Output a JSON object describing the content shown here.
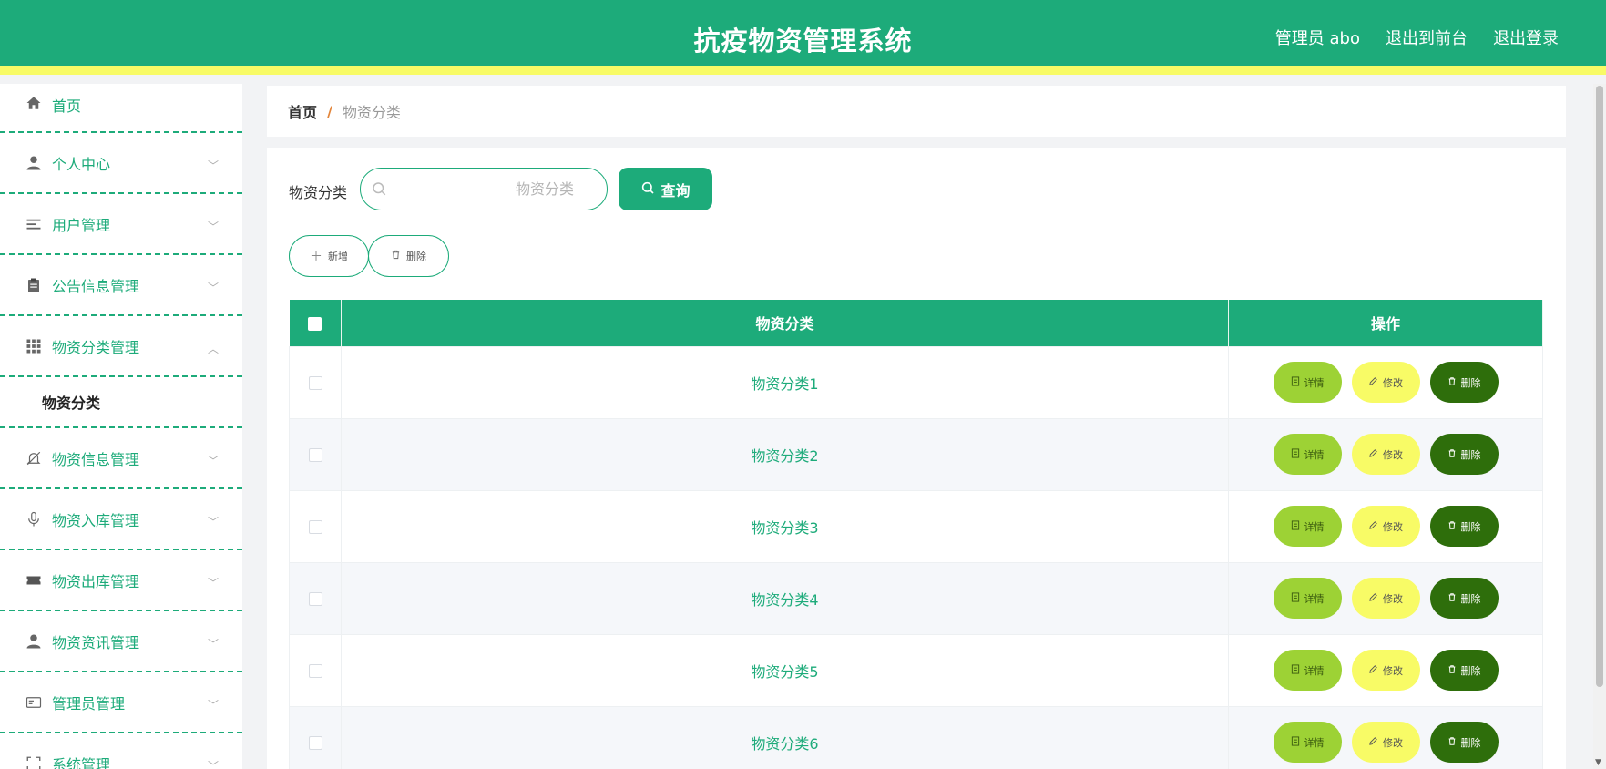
{
  "header": {
    "title": "抗疫物资管理系统",
    "user": "管理员 abo",
    "front_link": "退出到前台",
    "logout": "退出登录"
  },
  "sidebar": {
    "items": [
      {
        "label": "首页",
        "icon": "home-icon"
      },
      {
        "label": "个人中心",
        "icon": "user-icon"
      },
      {
        "label": "用户管理",
        "icon": "list-icon"
      },
      {
        "label": "公告信息管理",
        "icon": "clipboard-icon"
      },
      {
        "label": "物资分类管理",
        "icon": "grid-icon",
        "expanded": true,
        "sub": "物资分类"
      },
      {
        "label": "物资信息管理",
        "icon": "bell-off-icon"
      },
      {
        "label": "物资入库管理",
        "icon": "microphone-icon"
      },
      {
        "label": "物资出库管理",
        "icon": "ticket-icon"
      },
      {
        "label": "物资资讯管理",
        "icon": "person-icon"
      },
      {
        "label": "管理员管理",
        "icon": "id-card-icon"
      },
      {
        "label": "系统管理",
        "icon": "fullscreen-icon"
      }
    ]
  },
  "breadcrumb": {
    "home": "首页",
    "separator": "/",
    "current": "物资分类"
  },
  "search": {
    "label": "物资分类",
    "placeholder": "物资分类",
    "button": "查询"
  },
  "actions": {
    "add": "新增",
    "delete": "删除"
  },
  "table": {
    "headers": [
      "物资分类",
      "操作"
    ],
    "rows": [
      "物资分类1",
      "物资分类2",
      "物资分类3",
      "物资分类4",
      "物资分类5",
      "物资分类6"
    ],
    "ops": {
      "detail": "详情",
      "edit": "修改",
      "delete": "删除"
    }
  },
  "colors": {
    "primary": "#1dab7a",
    "accent_yellow": "#f8fb66",
    "detail_green": "#9dd235",
    "delete_dark": "#2e6e0b"
  }
}
